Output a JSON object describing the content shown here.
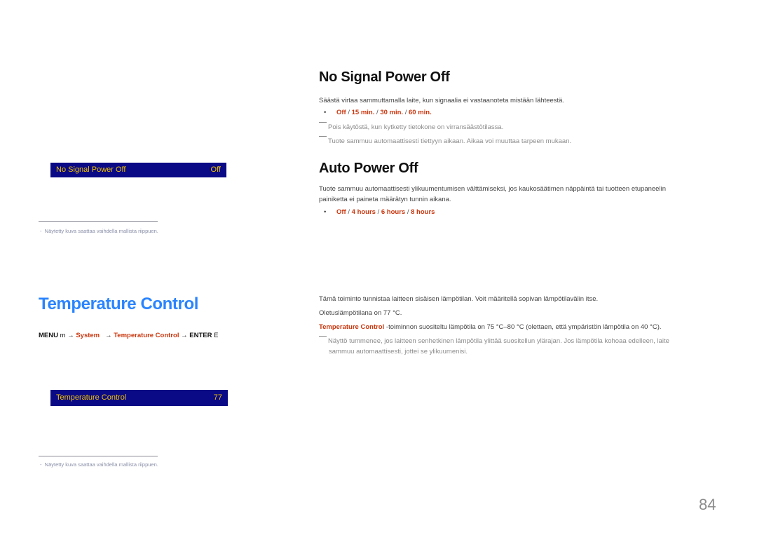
{
  "no_signal": {
    "heading": "No Signal Power Off",
    "description": "Säästä virtaa sammuttamalla laite, kun signaalia ei vastaanoteta mistään lähteestä.",
    "options": [
      "Off",
      "15 min.",
      "30 min.",
      "60 min."
    ],
    "separator": " / ",
    "notes": [
      "Pois käytöstä, kun kytketty tietokone on virransäästötilassa.",
      "Tuote sammuu automaattisesti tiettyyn aikaan. Aikaa voi muuttaa tarpeen mukaan."
    ],
    "osd": {
      "label": "No Signal Power Off",
      "value": "Off"
    }
  },
  "auto_power": {
    "heading": "Auto Power Off",
    "description_line1": "Tuote sammuu automaattisesti ylikuumentumisen välttämiseksi, jos kaukosäätimen näppäintä tai tuotteen etupaneelin",
    "description_line2": "painiketta ei paineta määrätyn tunnin aikana.",
    "options": [
      "Off",
      "4 hours",
      "6 hours",
      "8 hours"
    ]
  },
  "footnote": "Näytetty kuva saattaa vaihdella mallista riippuen.",
  "footnote_dash": "-",
  "temperature": {
    "title": "Temperature Control",
    "path": {
      "menu": "MENU",
      "menu_icon": "m",
      "arrow": "→",
      "system": "System",
      "item": "Temperature Control",
      "enter": "ENTER",
      "enter_icon": "E"
    },
    "osd": {
      "label": "Temperature Control",
      "value": "77"
    },
    "description": "Tämä toiminto tunnistaa laitteen sisäisen lämpötilan. Voit määritellä sopivan lämpötilavälin itse.",
    "default": "Oletuslämpötilana on 77 °C.",
    "recommended_label": "Temperature Control",
    "recommended_text": " -toiminnon suositeltu lämpötila on 75 °C–80 °C (olettaen, että ympäristön lämpötila on 40 °C).",
    "note_line1": "Näyttö tummenee, jos laitteen senhetkinen lämpötila ylittää suositellun ylärajan. Jos lämpötila kohoaa edelleen, laite",
    "note_line2": "sammuu automaattisesti, jottei se ylikuumenisi."
  },
  "page_number": "84",
  "bullet": "•"
}
